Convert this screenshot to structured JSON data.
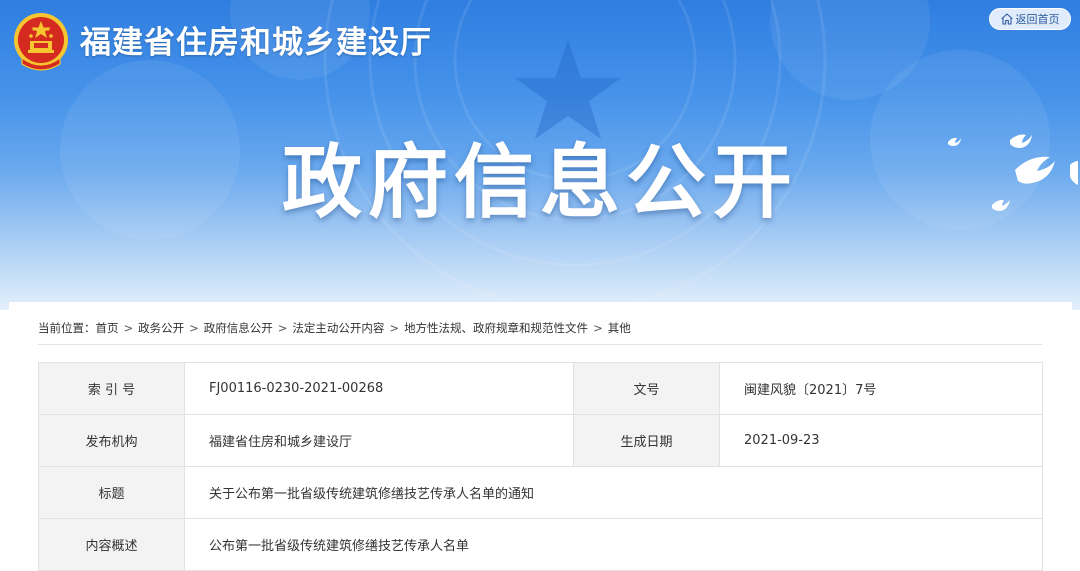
{
  "header": {
    "site_title": "福建省住房和城乡建设厅",
    "home_button_label": "返回首页",
    "hero_title": "政府信息公开",
    "colors": {
      "banner_top": "#2f7ee0",
      "banner_bottom": "#e4f0fb",
      "emblem_red": "#d52a1f",
      "emblem_gold": "#f6c530"
    },
    "icons": [
      "national-emblem-icon",
      "home-icon",
      "dove-icon"
    ]
  },
  "breadcrumb": {
    "prefix": "当前位置：",
    "separator": ">",
    "items": [
      "首页",
      "政务公开",
      "政府信息公开",
      "法定主动公开内容",
      "地方性法规、政府规章和规范性文件",
      "其他"
    ]
  },
  "metadata": {
    "rows": [
      {
        "label1": "索 引 号",
        "value1": "FJ00116-0230-2021-00268",
        "label2": "文号",
        "value2": "闽建风貌〔2021〕7号"
      },
      {
        "label1": "发布机构",
        "value1": "福建省住房和城乡建设厅",
        "label2": "生成日期",
        "value2": "2021-09-23"
      },
      {
        "label1": "标题",
        "value1": "关于公布第一批省级传统建筑修缮技艺传承人名单的通知"
      },
      {
        "label1": "内容概述",
        "value1": "公布第一批省级传统建筑修缮技艺传承人名单"
      }
    ]
  }
}
